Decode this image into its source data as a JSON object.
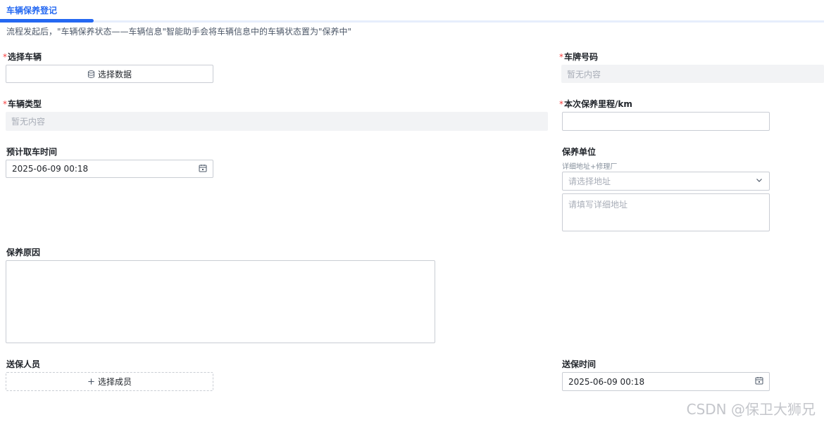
{
  "tab": {
    "title": "车辆保养登记"
  },
  "description": "流程发起后，\"车辆保养状态——车辆信息\"智能助手会将车辆信息中的车辆状态置为\"保养中\"",
  "required_mark": "*",
  "fields": {
    "vehicle": {
      "label": "选择车辆",
      "button": "选择数据",
      "icon": "database-icon"
    },
    "plate": {
      "label": "车牌号码",
      "value": "暂无内容"
    },
    "vehicle_type": {
      "label": "车辆类型",
      "value": "暂无内容"
    },
    "mileage": {
      "label": "本次保养里程/km",
      "value": ""
    },
    "pickup_time": {
      "label": "预计取车时间",
      "value": "2025-06-09 00:18",
      "icon": "calendar-icon"
    },
    "service_unit": {
      "label": "保养单位",
      "hint": "详细地址+修理厂",
      "select_placeholder": "请选择地址",
      "detail_placeholder": "请填写详细地址",
      "icon": "chevron-down-icon"
    },
    "reason": {
      "label": "保养原因",
      "value": ""
    },
    "sender": {
      "label": "送保人员",
      "button": "选择成员",
      "icon": "plus-icon"
    },
    "send_time": {
      "label": "送保时间",
      "value": "2025-06-09 00:18",
      "icon": "calendar-icon"
    }
  },
  "watermark": "CSDN @保卫大狮兄"
}
